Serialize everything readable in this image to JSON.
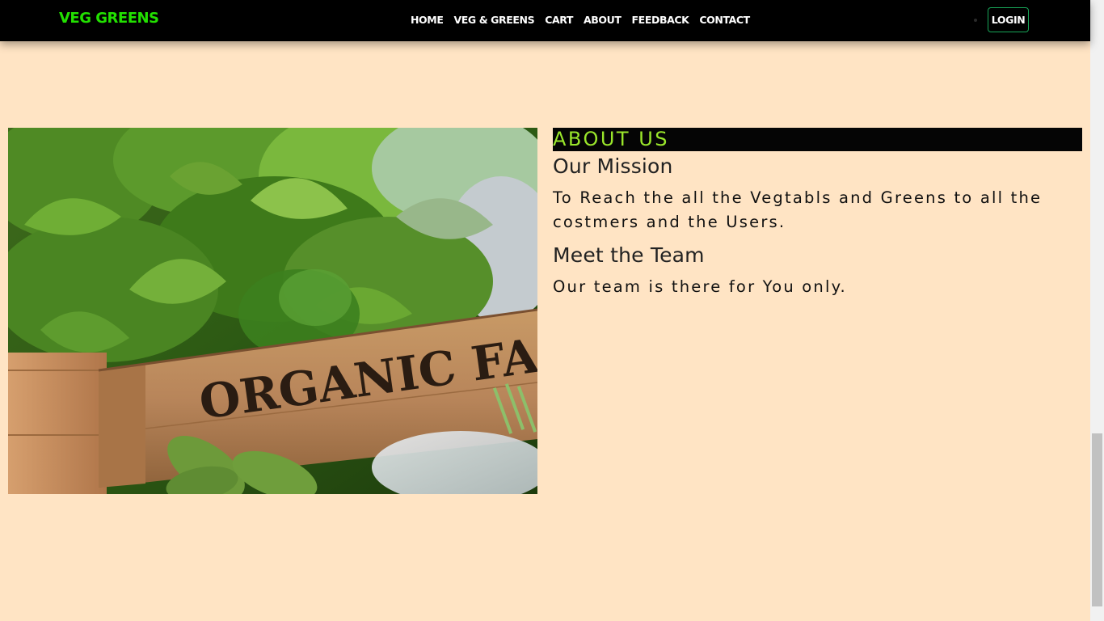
{
  "navbar": {
    "brand": "VEG GREENS",
    "links": [
      "HOME",
      "VEG & GREENS",
      "CART",
      "ABOUT",
      "FEEDBACK",
      "CONTACT"
    ],
    "login_label": "LOGIN"
  },
  "about": {
    "heading": "ABOUT US",
    "mission_title": "Our Mission",
    "mission_text": "To Reach the all the Vegtabls and Greens to all the costmers and the Users.",
    "team_title": "Meet the Team",
    "team_text": "Our team is there for You only."
  },
  "image": {
    "crate_text": "ORGANIC FARM"
  },
  "colors": {
    "page_bg": "#FFE4C4",
    "navbar_bg": "#000000",
    "brand": "#22E000",
    "heading_accent": "#9AE62B",
    "login_border": "#18A558"
  }
}
